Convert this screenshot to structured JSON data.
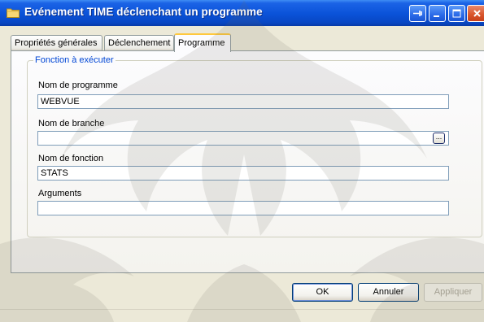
{
  "window": {
    "title": "Evénement TIME déclenchant un programme",
    "title_icon": "folder-icon",
    "controls": [
      "pin-icon",
      "minimize-icon",
      "maximize-icon",
      "close-icon"
    ]
  },
  "tabs": [
    {
      "label": "Propriétés générales",
      "active": false
    },
    {
      "label": "Déclenchement",
      "active": false
    },
    {
      "label": "Programme",
      "active": true
    }
  ],
  "group": {
    "legend": "Fonction à exécuter",
    "fields": [
      {
        "label": "Nom de programme",
        "value": "WEBVUE"
      },
      {
        "label": "Nom de branche",
        "value": "",
        "browse_label": "..."
      },
      {
        "label": "Nom de fonction",
        "value": "STATS"
      },
      {
        "label": "Arguments",
        "value": ""
      }
    ]
  },
  "buttons": {
    "ok": "OK",
    "cancel": "Annuler",
    "apply": "Appliquer"
  },
  "colors": {
    "titlebar": "#0a52d8",
    "legend": "#0046d5",
    "active_tab_accent": "#ffc83c",
    "window_bg": "#ece9d8"
  }
}
